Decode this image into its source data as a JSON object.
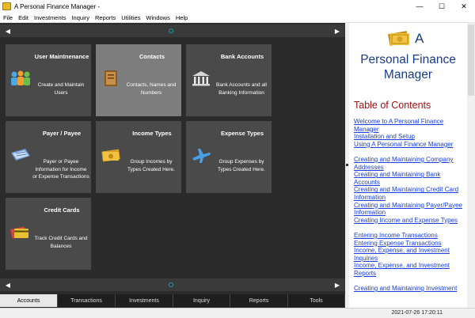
{
  "window": {
    "title": "A Personal Finance Manager -",
    "min": "—",
    "max": "☐",
    "close": "✕"
  },
  "menu": [
    "File",
    "Edit",
    "Investments",
    "Inquiry",
    "Reports",
    "Utilities",
    "Windows",
    "Help"
  ],
  "scroll": {
    "left": "◀",
    "right": "▶"
  },
  "tiles": [
    {
      "title": "User Maintnenance",
      "desc": "Create and Maintain Users",
      "icon": "users-icon"
    },
    {
      "title": "Contacts",
      "desc": "Contacts, Names and Numbers",
      "icon": "address-book-icon"
    },
    {
      "title": "Bank Accounts",
      "desc": "Bank Accounts and all Banking Information",
      "icon": "bank-icon"
    },
    {
      "title": "Payer / Payee",
      "desc": "Payer or Payee Information for Income or Expense Transactions",
      "icon": "ledger-icon"
    },
    {
      "title": "Income Types",
      "desc": "Group Incomes by Types Created Here.",
      "icon": "money-icon"
    },
    {
      "title": "Expense Types",
      "desc": "Group Expenses by Types Created Here.",
      "icon": "airplane-icon"
    },
    {
      "title": "Credit Cards",
      "desc": "Track Credit Cards and Balances",
      "icon": "credit-cards-icon"
    }
  ],
  "tabs": [
    "Accounts",
    "Transactions",
    "Investments",
    "Inquiry",
    "Reports",
    "Tools"
  ],
  "help": {
    "logo_letter": "A",
    "app_name": "Personal Finance Manager",
    "toc_title": "Table of Contents",
    "links": [
      "Welcome to A Personal Finance Manager",
      "Installation and Setup",
      "Using A Personal Finance Manager",
      "",
      "Creating and Maintaining Company Addresses",
      "Creating and Maintaining Bank Accounts",
      "Creating and Maintaining Credit Card Information",
      "Creating and Maintaining Payer/Payee Information",
      "Creating Income and Expense Types",
      "",
      "Entering Income Transactions",
      "Entering Expense Transactions",
      "Income, Expense, and Investment Inquiries",
      "Income, Expense, and Investment Reports",
      "",
      "Creating and Maintaining Investment"
    ]
  },
  "status": {
    "datetime": "2021-07-26 17:20:11"
  },
  "colors": {
    "tile_dark": "#4a4a4a",
    "tile_light": "#7d7d7d",
    "pane_bg": "#2b2b2b",
    "help_link": "#1a3ee0",
    "toc_red": "#a01010"
  }
}
